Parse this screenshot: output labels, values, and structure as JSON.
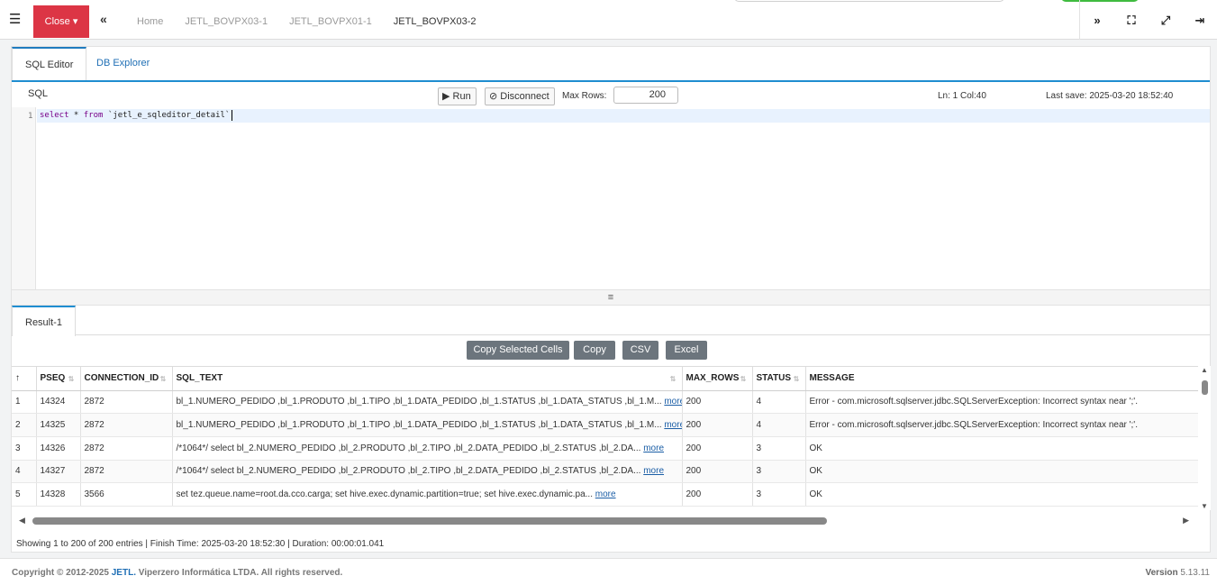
{
  "topbar": {
    "close_label": "Close ▾",
    "tabs": [
      "Home",
      "JETL_BOVPX03-1",
      "JETL_BOVPX01-1",
      "JETL_BOVPX03-2"
    ],
    "active_tab": "JETL_BOVPX03-2"
  },
  "panel_tabs": {
    "sql_editor": "SQL Editor",
    "db_explorer": "DB Explorer"
  },
  "sql_toolbar": {
    "label": "SQL",
    "run": "Run",
    "disconnect": "Disconnect",
    "max_rows_label": "Max Rows:",
    "max_rows_value": "200",
    "cursor_pos": "Ln: 1 Col:40",
    "last_save": "Last save: 2025-03-20 18:52:40"
  },
  "editor": {
    "line_number": "1",
    "kw_select": "select",
    "star": " * ",
    "kw_from": "from",
    "table": " `jetl_e_sqleditor_detail`"
  },
  "splitter_glyph": "≡",
  "result_tab": "Result-1",
  "result_buttons": {
    "copy_selected": "Copy Selected Cells",
    "copy": "Copy",
    "csv": "CSV",
    "excel": "Excel"
  },
  "grid": {
    "columns": [
      "",
      "PSEQ",
      "CONNECTION_ID",
      "SQL_TEXT",
      "MAX_ROWS",
      "STATUS",
      "MESSAGE"
    ],
    "more_label": "more",
    "rows": [
      {
        "n": "1",
        "pseq": "14324",
        "conn": "2872",
        "sql": "bl_1.NUMERO_PEDIDO ,bl_1.PRODUTO ,bl_1.TIPO ,bl_1.DATA_PEDIDO ,bl_1.STATUS ,bl_1.DATA_STATUS ,bl_1.M...",
        "max": "200",
        "status": "4",
        "msg": "Error - com.microsoft.sqlserver.jdbc.SQLServerException: Incorrect syntax near ';'."
      },
      {
        "n": "2",
        "pseq": "14325",
        "conn": "2872",
        "sql": "bl_1.NUMERO_PEDIDO ,bl_1.PRODUTO ,bl_1.TIPO ,bl_1.DATA_PEDIDO ,bl_1.STATUS ,bl_1.DATA_STATUS ,bl_1.M...",
        "max": "200",
        "status": "4",
        "msg": "Error - com.microsoft.sqlserver.jdbc.SQLServerException: Incorrect syntax near ';'."
      },
      {
        "n": "3",
        "pseq": "14326",
        "conn": "2872",
        "sql": "/*1064*/ select bl_2.NUMERO_PEDIDO ,bl_2.PRODUTO ,bl_2.TIPO ,bl_2.DATA_PEDIDO ,bl_2.STATUS ,bl_2.DA...",
        "max": "200",
        "status": "3",
        "msg": "OK"
      },
      {
        "n": "4",
        "pseq": "14327",
        "conn": "2872",
        "sql": "/*1064*/ select bl_2.NUMERO_PEDIDO ,bl_2.PRODUTO ,bl_2.TIPO ,bl_2.DATA_PEDIDO ,bl_2.STATUS ,bl_2.DA...",
        "max": "200",
        "status": "3",
        "msg": "OK"
      },
      {
        "n": "5",
        "pseq": "14328",
        "conn": "3566",
        "sql": "set tez.queue.name=root.da.cco.carga; set hive.exec.dynamic.partition=true; set hive.exec.dynamic.pa...",
        "max": "200",
        "status": "3",
        "msg": "OK"
      }
    ]
  },
  "status_line": "Showing 1 to 200 of 200 entries | Finish Time: 2025-03-20 18:52:30 | Duration: 00:00:01.041",
  "footer": {
    "copyright_pre": "Copyright © 2012-2025 ",
    "brand": "JETL.",
    "copyright_post": " Viperzero Informática LTDA. All rights reserved.",
    "version_label": "Version",
    "version": " 5.13.11"
  }
}
